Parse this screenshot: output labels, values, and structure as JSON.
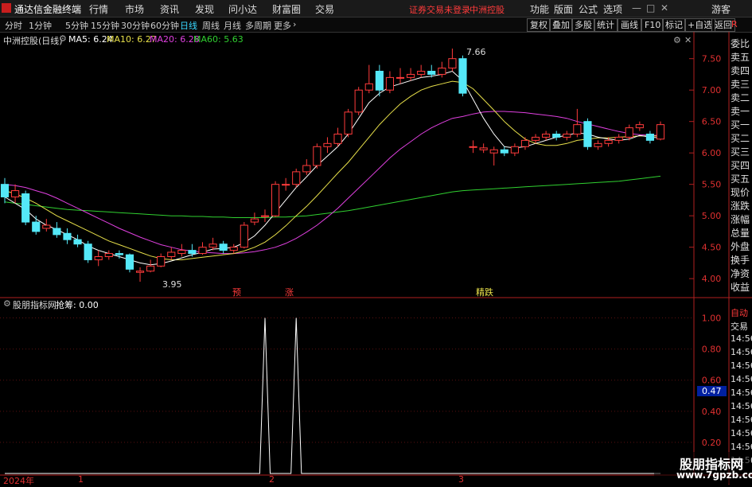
{
  "menubar": {
    "app_title": "通达信金融终端",
    "items": [
      "行情",
      "市场",
      "资讯",
      "发现",
      "问小达",
      "财富圈",
      "交易"
    ],
    "warning": "证券交易未登录",
    "stock_name": "中洲控股",
    "right_items": [
      "功能",
      "版面",
      "公式",
      "选项"
    ],
    "guest": "游客",
    "window_controls": [
      "—",
      "□",
      "✕"
    ]
  },
  "toolbar": {
    "timeframes": [
      "分时",
      "1分钟",
      "5分钟",
      "15分钟",
      "30分钟",
      "60分钟",
      "日线",
      "周线",
      "月线",
      "多周期",
      "更多"
    ],
    "active_timeframe": "日线",
    "buttons": [
      "复权",
      "叠加",
      "多股",
      "统计",
      "画线",
      "F10",
      "标记",
      "+自选",
      "返回"
    ]
  },
  "main_panel": {
    "title": "中洲控股(日线)",
    "indicators": [
      {
        "label": "MA5: 6.24",
        "color": "#ffffff"
      },
      {
        "label": "MA10: 6.27",
        "color": "#e8e04a"
      },
      {
        "label": "MA20: 6.28",
        "color": "#e040e0"
      },
      {
        "label": "MA60: 5.63",
        "color": "#30d030"
      }
    ],
    "high_label": "7.66",
    "low_label": "3.95",
    "y_ticks": [
      "7.50",
      "7.00",
      "6.50",
      "6.00",
      "5.50",
      "5.00",
      "4.50",
      "4.00"
    ],
    "signal_labels": [
      "预",
      "涨",
      "精跌"
    ]
  },
  "sub_panel": {
    "title": "股朋指标网",
    "value_label": "抢筹: 0.00",
    "y_ticks": [
      "1.00",
      "0.80",
      "0.60",
      "0.40",
      "0.20"
    ],
    "current_value": "0.47"
  },
  "x_axis": {
    "labels": [
      "2024年",
      "1",
      "2",
      "3"
    ]
  },
  "right_panel": {
    "items": [
      "委比",
      "卖五",
      "卖四",
      "卖三",
      "卖二",
      "卖一",
      "买一",
      "买二",
      "买三",
      "买四",
      "买五",
      "现价",
      "涨跌",
      "涨幅",
      "总量",
      "外盘",
      "换手",
      "净资",
      "收益"
    ],
    "sub_items": [
      "自动",
      "交易",
      "14:56",
      "14:56",
      "14:56",
      "14:56",
      "14:56",
      "14:56",
      "14:56",
      "14:56",
      "14:56",
      "14:56"
    ],
    "top_badge": "R"
  },
  "watermark": {
    "line1": "股朋指标网",
    "line2": "www.7gpzb.com"
  },
  "colors": {
    "up": "#ff3b3b",
    "down": "#54e8f8",
    "ma5": "#ffffff",
    "ma10": "#e8e04a",
    "ma20": "#e040e0",
    "ma60": "#30d030",
    "signal": "#ffffff"
  },
  "chart_data": {
    "type": "candlestick",
    "y_range": [
      3.85,
      7.8
    ],
    "candles": [
      [
        5.5,
        5.3,
        5.6,
        5.2
      ],
      [
        5.3,
        5.4,
        5.5,
        5.2
      ],
      [
        5.35,
        4.9,
        5.4,
        4.85
      ],
      [
        4.9,
        4.75,
        5.0,
        4.7
      ],
      [
        4.8,
        4.85,
        4.95,
        4.75
      ],
      [
        4.8,
        4.7,
        4.9,
        4.65
      ],
      [
        4.72,
        4.62,
        4.8,
        4.55
      ],
      [
        4.62,
        4.55,
        4.7,
        4.5
      ],
      [
        4.55,
        4.3,
        4.6,
        4.25
      ],
      [
        4.3,
        4.35,
        4.45,
        4.2
      ],
      [
        4.35,
        4.4,
        4.45,
        4.3
      ],
      [
        4.4,
        4.38,
        4.45,
        4.32
      ],
      [
        4.38,
        4.15,
        4.4,
        4.1
      ],
      [
        4.1,
        4.12,
        4.18,
        3.95
      ],
      [
        4.12,
        4.2,
        4.3,
        4.1
      ],
      [
        4.2,
        4.35,
        4.4,
        4.18
      ],
      [
        4.35,
        4.42,
        4.5,
        4.3
      ],
      [
        4.4,
        4.45,
        4.55,
        4.35
      ],
      [
        4.45,
        4.4,
        4.55,
        4.35
      ],
      [
        4.4,
        4.5,
        4.58,
        4.38
      ],
      [
        4.5,
        4.55,
        4.65,
        4.45
      ],
      [
        4.55,
        4.45,
        4.6,
        4.4
      ],
      [
        4.45,
        4.5,
        4.55,
        4.4
      ],
      [
        4.5,
        4.85,
        4.9,
        4.48
      ],
      [
        4.9,
        4.95,
        5.05,
        4.85
      ],
      [
        5.0,
        5.0,
        5.1,
        4.9
      ],
      [
        5.0,
        5.5,
        5.55,
        4.98
      ],
      [
        5.5,
        5.5,
        5.6,
        5.4
      ],
      [
        5.5,
        5.7,
        5.75,
        5.45
      ],
      [
        5.7,
        5.8,
        5.9,
        5.65
      ],
      [
        5.8,
        6.1,
        6.15,
        5.75
      ],
      [
        6.1,
        6.15,
        6.25,
        6.0
      ],
      [
        6.15,
        6.3,
        6.4,
        6.1
      ],
      [
        6.3,
        6.65,
        6.7,
        6.25
      ],
      [
        6.65,
        7.0,
        7.05,
        6.6
      ],
      [
        7.0,
        7.1,
        7.4,
        6.95
      ],
      [
        7.3,
        7.0,
        7.4,
        6.9
      ],
      [
        7.0,
        7.2,
        7.3,
        6.95
      ],
      [
        7.2,
        7.2,
        7.35,
        7.1
      ],
      [
        7.2,
        7.25,
        7.35,
        7.15
      ],
      [
        7.25,
        7.3,
        7.4,
        7.2
      ],
      [
        7.3,
        7.25,
        7.4,
        7.2
      ],
      [
        7.25,
        7.35,
        7.45,
        7.2
      ],
      [
        7.35,
        7.5,
        7.66,
        7.3
      ],
      [
        7.5,
        6.95,
        7.55,
        6.9
      ],
      [
        6.1,
        6.1,
        6.2,
        6.0
      ],
      [
        6.05,
        6.08,
        6.15,
        6.0
      ],
      [
        6.0,
        6.05,
        6.1,
        5.8
      ],
      [
        6.05,
        6.0,
        6.1,
        5.95
      ],
      [
        6.0,
        6.1,
        6.15,
        5.95
      ],
      [
        6.1,
        6.2,
        6.25,
        6.05
      ],
      [
        6.2,
        6.25,
        6.3,
        6.15
      ],
      [
        6.25,
        6.3,
        6.35,
        6.2
      ],
      [
        6.3,
        6.25,
        6.35,
        6.2
      ],
      [
        6.25,
        6.3,
        6.35,
        6.2
      ],
      [
        6.3,
        6.45,
        6.7,
        6.25
      ],
      [
        6.5,
        6.1,
        6.55,
        6.05
      ],
      [
        6.1,
        6.15,
        6.2,
        6.05
      ],
      [
        6.15,
        6.2,
        6.25,
        6.1
      ],
      [
        6.2,
        6.25,
        6.3,
        6.15
      ],
      [
        6.25,
        6.4,
        6.45,
        6.2
      ],
      [
        6.4,
        6.45,
        6.5,
        6.35
      ],
      [
        6.3,
        6.2,
        6.35,
        6.15
      ],
      [
        6.22,
        6.45,
        6.5,
        6.2
      ]
    ],
    "ma5": [
      5.3,
      5.2,
      5.1,
      4.95,
      4.85,
      4.78,
      4.7,
      4.62,
      4.52,
      4.45,
      4.4,
      4.35,
      4.3,
      4.25,
      4.22,
      4.24,
      4.28,
      4.33,
      4.38,
      4.42,
      4.47,
      4.48,
      4.5,
      4.57,
      4.68,
      4.85,
      5.05,
      5.25,
      5.45,
      5.62,
      5.8,
      5.95,
      6.1,
      6.3,
      6.55,
      6.8,
      6.95,
      7.05,
      7.1,
      7.15,
      7.2,
      7.22,
      7.25,
      7.3,
      7.15,
      6.85,
      6.55,
      6.3,
      6.1,
      6.08,
      6.1,
      6.15,
      6.2,
      6.25,
      6.28,
      6.32,
      6.3,
      6.25,
      6.22,
      6.2,
      6.22,
      6.28,
      6.25,
      6.24
    ],
    "ma10": [
      5.4,
      5.35,
      5.28,
      5.2,
      5.1,
      5.0,
      4.92,
      4.84,
      4.76,
      4.68,
      4.6,
      4.54,
      4.48,
      4.42,
      4.36,
      4.32,
      4.3,
      4.3,
      4.32,
      4.34,
      4.36,
      4.38,
      4.4,
      4.44,
      4.5,
      4.58,
      4.7,
      4.84,
      5.0,
      5.15,
      5.32,
      5.5,
      5.68,
      5.85,
      6.05,
      6.25,
      6.45,
      6.62,
      6.78,
      6.9,
      7.0,
      7.06,
      7.1,
      7.14,
      7.12,
      7.02,
      6.85,
      6.68,
      6.5,
      6.35,
      6.22,
      6.15,
      6.12,
      6.12,
      6.15,
      6.2,
      6.22,
      6.24,
      6.24,
      6.25,
      6.26,
      6.27,
      6.27,
      6.27
    ],
    "ma20": [
      5.5,
      5.48,
      5.45,
      5.4,
      5.35,
      5.28,
      5.2,
      5.12,
      5.04,
      4.96,
      4.88,
      4.8,
      4.73,
      4.66,
      4.6,
      4.54,
      4.5,
      4.46,
      4.44,
      4.42,
      4.41,
      4.4,
      4.4,
      4.41,
      4.43,
      4.46,
      4.5,
      4.56,
      4.64,
      4.74,
      4.85,
      4.98,
      5.12,
      5.28,
      5.44,
      5.6,
      5.76,
      5.92,
      6.06,
      6.18,
      6.3,
      6.4,
      6.48,
      6.55,
      6.58,
      6.62,
      6.65,
      6.66,
      6.66,
      6.65,
      6.64,
      6.62,
      6.6,
      6.58,
      6.55,
      6.5,
      6.46,
      6.42,
      6.38,
      6.34,
      6.31,
      6.29,
      6.28,
      6.28
    ],
    "ma60": [
      5.22,
      5.2,
      5.18,
      5.16,
      5.14,
      5.12,
      5.1,
      5.09,
      5.08,
      5.07,
      5.06,
      5.05,
      5.04,
      5.03,
      5.02,
      5.01,
      5.0,
      5.0,
      4.99,
      4.99,
      4.98,
      4.98,
      4.97,
      4.97,
      4.97,
      4.97,
      4.98,
      4.98,
      4.99,
      5.0,
      5.02,
      5.04,
      5.06,
      5.08,
      5.11,
      5.14,
      5.17,
      5.2,
      5.23,
      5.26,
      5.29,
      5.32,
      5.35,
      5.38,
      5.4,
      5.41,
      5.42,
      5.43,
      5.44,
      5.45,
      5.46,
      5.47,
      5.48,
      5.49,
      5.5,
      5.51,
      5.52,
      5.53,
      5.54,
      5.55,
      5.57,
      5.59,
      5.61,
      5.63
    ],
    "signal_y_range": [
      0,
      1.1
    ],
    "signal": [
      0,
      0,
      0,
      0,
      0,
      0,
      0,
      0,
      0,
      0,
      0,
      0,
      0,
      0,
      0,
      0,
      0,
      0,
      0,
      0,
      0,
      0,
      0,
      0,
      0,
      1,
      0,
      0,
      1,
      0,
      0,
      0,
      0,
      0,
      0,
      0,
      0,
      0,
      0,
      0,
      0,
      0,
      0,
      0,
      0,
      0,
      0,
      0,
      0,
      0,
      0,
      0,
      0,
      0,
      0,
      0,
      0,
      0,
      0,
      0,
      0,
      0,
      0,
      0
    ]
  }
}
